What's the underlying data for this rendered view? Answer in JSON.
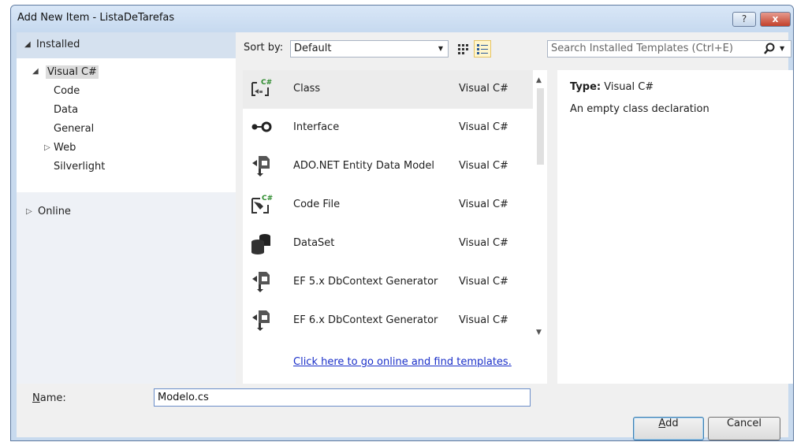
{
  "window": {
    "title": "Add New Item - ListaDeTarefas",
    "help_label": "?",
    "close_label": "x"
  },
  "tree": {
    "installed_label": "Installed",
    "root_label": "Visual C#",
    "children": [
      "Code",
      "Data",
      "General",
      "Web",
      "Silverlight"
    ],
    "online_label": "Online"
  },
  "sort": {
    "label": "Sort by:",
    "value": "Default"
  },
  "search": {
    "placeholder": "Search Installed Templates (Ctrl+E)"
  },
  "templates": [
    {
      "name": "Class",
      "lang": "Visual C#",
      "icon": "class-icon"
    },
    {
      "name": "Interface",
      "lang": "Visual C#",
      "icon": "interface-icon"
    },
    {
      "name": "ADO.NET Entity Data Model",
      "lang": "Visual C#",
      "icon": "entity-model-icon"
    },
    {
      "name": "Code File",
      "lang": "Visual C#",
      "icon": "code-file-icon"
    },
    {
      "name": "DataSet",
      "lang": "Visual C#",
      "icon": "dataset-icon"
    },
    {
      "name": "EF 5.x DbContext Generator",
      "lang": "Visual C#",
      "icon": "ef-generator-icon"
    },
    {
      "name": "EF 6.x DbContext Generator",
      "lang": "Visual C#",
      "icon": "ef-generator-icon"
    }
  ],
  "online_link": "Click here to go online and find templates.",
  "detail": {
    "type_label": "Type:",
    "type_value": "Visual C#",
    "description": "An empty class declaration"
  },
  "name_field": {
    "label_first": "N",
    "label_rest": "ame:",
    "value": "Modelo.cs"
  },
  "buttons": {
    "add_first": "A",
    "add_rest": "dd",
    "cancel": "Cancel"
  }
}
